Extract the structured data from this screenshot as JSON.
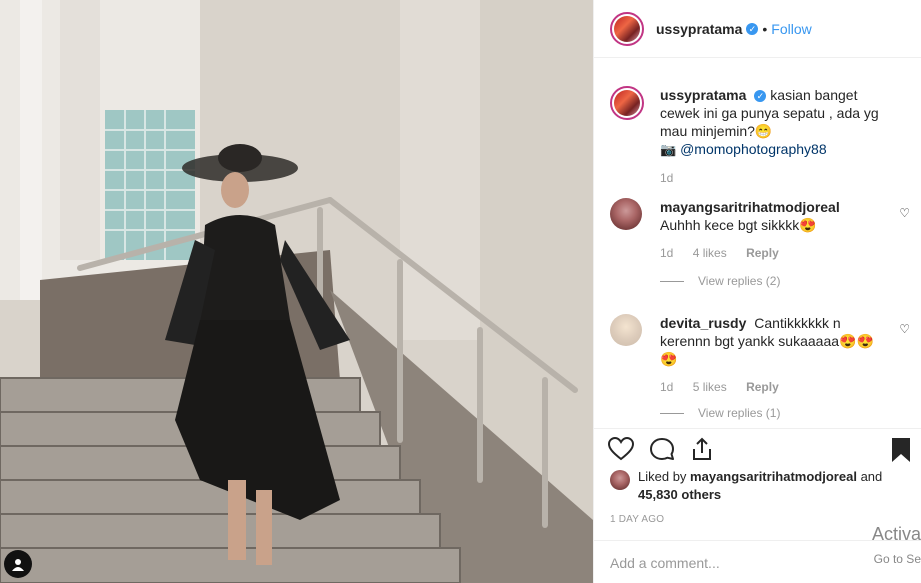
{
  "post": {
    "author": "ussypratama",
    "follow_label": "Follow",
    "dot": "•",
    "verified_mark": "✓",
    "caption": "kasian banget cewek ini ga punya sepatu , ada yg mau minjemin?😁",
    "credit_icon": "📷",
    "credit_link": "@momophotography88",
    "caption_age": "1d"
  },
  "comments": [
    {
      "author": "mayangsaritrihatmodjoreal",
      "text": "Auhhh kece bgt sikkkk😍",
      "age": "1d",
      "likes": "4 likes",
      "reply_label": "Reply",
      "view_replies": "View replies (2)"
    },
    {
      "author": "devita_rusdy",
      "text": "Cantikkkkkk n kerennn bgt yankk sukaaaaa😍😍😍",
      "age": "1d",
      "likes": "5 likes",
      "reply_label": "Reply",
      "view_replies": "View replies (1)"
    }
  ],
  "liked_by": {
    "prefix": "Liked by",
    "user": "mayangsaritrihatmodjoreal",
    "and": "and",
    "others": "45,830 others"
  },
  "timestamp": "1 DAY AGO",
  "comment_input": {
    "placeholder": "Add a comment..."
  },
  "watermark": {
    "line1": "Activa",
    "line2": "Go to Se"
  },
  "icons": {
    "like": "heart-icon",
    "comment": "comment-icon",
    "share": "share-icon",
    "save": "bookmark-icon",
    "comment_like": "small-heart-icon"
  },
  "colors": {
    "link": "#3897f0",
    "muted": "#999999",
    "verified": "#3897f0",
    "story_ring": "#c13584"
  }
}
